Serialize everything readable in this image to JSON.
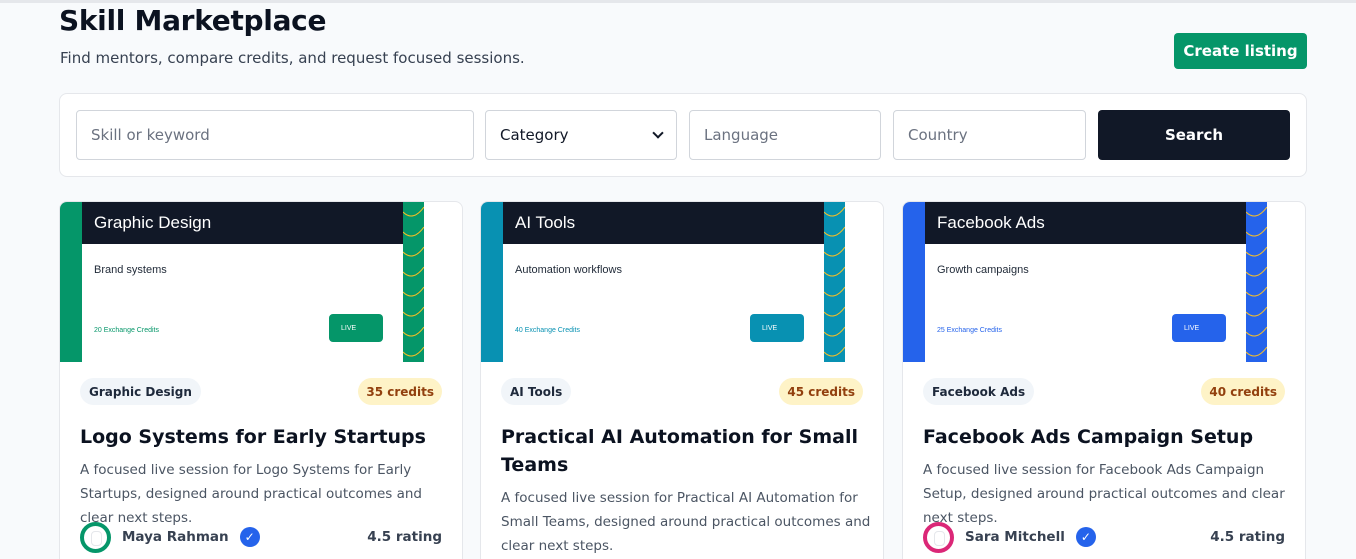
{
  "header": {
    "title": "Skill Marketplace",
    "subtitle": "Find mentors, compare credits, and request focused sessions.",
    "create_label": "Create listing"
  },
  "search": {
    "keyword_placeholder": "Skill or keyword",
    "category_selected": "Category",
    "language_placeholder": "Language",
    "country_placeholder": "Country",
    "search_label": "Search"
  },
  "listings": [
    {
      "accent": "#059669",
      "thumb_title": "Graphic Design",
      "thumb_subtitle": "Brand systems",
      "thumb_credits": "20 Exchange Credits",
      "thumb_live": "LIVE",
      "category": "Graphic Design",
      "credits": "35 credits",
      "title": "Logo Systems for Early Startups",
      "description": "A focused live session for Logo Systems for Early Startups, designed around practical outcomes and clear next steps.",
      "mentor": "Maya Rahman",
      "avatar_color": "#059669",
      "rating": "4.5 rating"
    },
    {
      "accent": "#0891b2",
      "thumb_title": "AI Tools",
      "thumb_subtitle": "Automation workflows",
      "thumb_credits": "40 Exchange Credits",
      "thumb_live": "LIVE",
      "category": "AI Tools",
      "credits": "45 credits",
      "title": "Practical AI Automation for Small Teams",
      "description": "A focused live session for Practical AI Automation for Small Teams, designed around practical outcomes and clear next steps.",
      "mentor": "",
      "avatar_color": "#0891b2",
      "rating": ""
    },
    {
      "accent": "#2563eb",
      "thumb_title": "Facebook Ads",
      "thumb_subtitle": "Growth campaigns",
      "thumb_credits": "25 Exchange Credits",
      "thumb_live": "LIVE",
      "category": "Facebook Ads",
      "credits": "40 credits",
      "title": "Facebook Ads Campaign Setup",
      "description": "A focused live session for Facebook Ads Campaign Setup, designed around practical outcomes and clear next steps.",
      "mentor": "Sara Mitchell",
      "avatar_color": "#db2777",
      "rating": "4.5 rating"
    }
  ]
}
